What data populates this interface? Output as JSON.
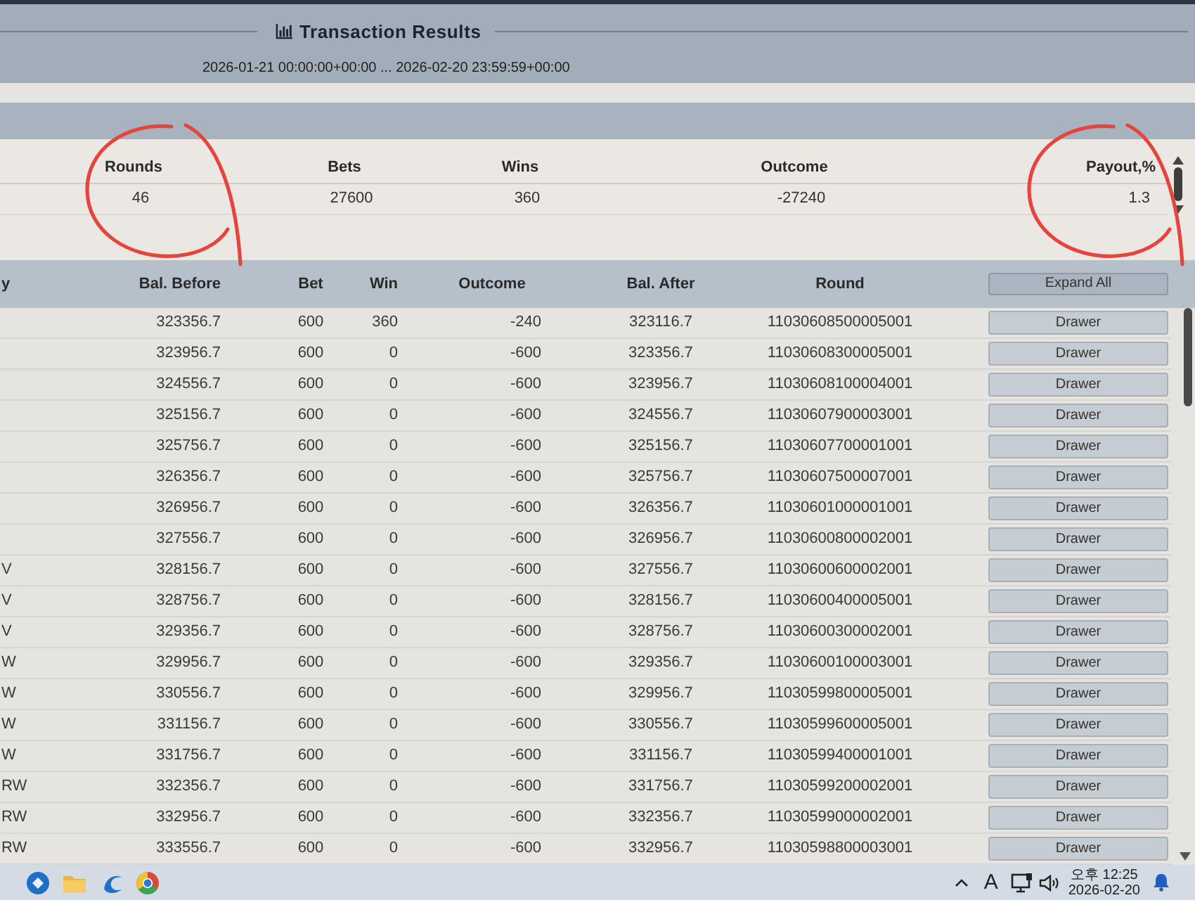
{
  "header": {
    "title": "Transaction Results",
    "date_range": "2026-01-21 00:00:00+00:00 ... 2026-02-20 23:59:59+00:00"
  },
  "summary": {
    "columns": [
      {
        "label": "Rounds",
        "value": "46",
        "circled": true
      },
      {
        "label": "Bets",
        "value": "27600",
        "circled": false
      },
      {
        "label": "Wins",
        "value": "360",
        "circled": false
      },
      {
        "label": "Outcome",
        "value": "-27240",
        "circled": false
      },
      {
        "label": "Payout,%",
        "value": "1.3",
        "circled": true
      }
    ]
  },
  "transactions": {
    "columns": [
      "y",
      "Bal. Before",
      "Bet",
      "Win",
      "Outcome",
      "Bal. After",
      "Round"
    ],
    "expand_button": "Expand All",
    "rows": [
      {
        "bal_before": "323356.7",
        "bet": "600",
        "win": "360",
        "outcome": "-240",
        "bal_after": "323116.7",
        "round": "11030608500005001",
        "button": "Drawer"
      },
      {
        "bal_before": "323956.7",
        "bet": "600",
        "win": "0",
        "outcome": "-600",
        "bal_after": "323356.7",
        "round": "11030608300005001",
        "button": "Drawer"
      },
      {
        "bal_before": "324556.7",
        "bet": "600",
        "win": "0",
        "outcome": "-600",
        "bal_after": "323956.7",
        "round": "11030608100004001",
        "button": "Drawer"
      },
      {
        "bal_before": "325156.7",
        "bet": "600",
        "win": "0",
        "outcome": "-600",
        "bal_after": "324556.7",
        "round": "11030607900003001",
        "button": "Drawer"
      },
      {
        "bal_before": "325756.7",
        "bet": "600",
        "win": "0",
        "outcome": "-600",
        "bal_after": "325156.7",
        "round": "11030607700001001",
        "button": "Drawer"
      },
      {
        "bal_before": "326356.7",
        "bet": "600",
        "win": "0",
        "outcome": "-600",
        "bal_after": "325756.7",
        "round": "11030607500007001",
        "button": "Drawer"
      },
      {
        "bal_before": "326956.7",
        "bet": "600",
        "win": "0",
        "outcome": "-600",
        "bal_after": "326356.7",
        "round": "11030601000001001",
        "button": "Drawer"
      },
      {
        "bal_before": "327556.7",
        "bet": "600",
        "win": "0",
        "outcome": "-600",
        "bal_after": "326956.7",
        "round": "11030600800002001",
        "button": "Drawer"
      },
      {
        "column_1": "V",
        "bal_before": "328156.7",
        "bet": "600",
        "win": "0",
        "outcome": "-600",
        "bal_after": "327556.7",
        "round": "11030600600002001",
        "button": "Drawer"
      },
      {
        "column_1": "V",
        "bal_before": "328756.7",
        "bet": "600",
        "win": "0",
        "outcome": "-600",
        "bal_after": "328156.7",
        "round": "11030600400005001",
        "button": "Drawer"
      },
      {
        "column_1": "V",
        "bal_before": "329356.7",
        "bet": "600",
        "win": "0",
        "outcome": "-600",
        "bal_after": "328756.7",
        "round": "11030600300002001",
        "button": "Drawer"
      },
      {
        "column_1": "W",
        "bal_before": "329956.7",
        "bet": "600",
        "win": "0",
        "outcome": "-600",
        "bal_after": "329356.7",
        "round": "11030600100003001",
        "button": "Drawer"
      },
      {
        "column_1": "W",
        "bal_before": "330556.7",
        "bet": "600",
        "win": "0",
        "outcome": "-600",
        "bal_after": "329956.7",
        "round": "11030599800005001",
        "button": "Drawer"
      },
      {
        "column_1": "W",
        "bal_before": "331156.7",
        "bet": "600",
        "win": "0",
        "outcome": "-600",
        "bal_after": "330556.7",
        "round": "11030599600005001",
        "button": "Drawer"
      },
      {
        "column_1": "W",
        "bal_before": "331756.7",
        "bet": "600",
        "win": "0",
        "outcome": "-600",
        "bal_after": "331156.7",
        "round": "11030599400001001",
        "button": "Drawer"
      },
      {
        "column_1": "RW",
        "bal_before": "332356.7",
        "bet": "600",
        "win": "0",
        "outcome": "-600",
        "bal_after": "331756.7",
        "round": "11030599200002001",
        "button": "Drawer"
      },
      {
        "column_1": "RW",
        "bal_before": "332956.7",
        "bet": "600",
        "win": "0",
        "outcome": "-600",
        "bal_after": "332356.7",
        "round": "11030599000002001",
        "button": "Drawer"
      },
      {
        "column_1": "RW",
        "bal_before": "333556.7",
        "bet": "600",
        "win": "0",
        "outcome": "-600",
        "bal_after": "332956.7",
        "round": "11030598800003001",
        "button": "Drawer"
      }
    ]
  },
  "taskbar": {
    "input_indicator": "A",
    "time": "오후 12:25",
    "date": "2026-02-20"
  }
}
